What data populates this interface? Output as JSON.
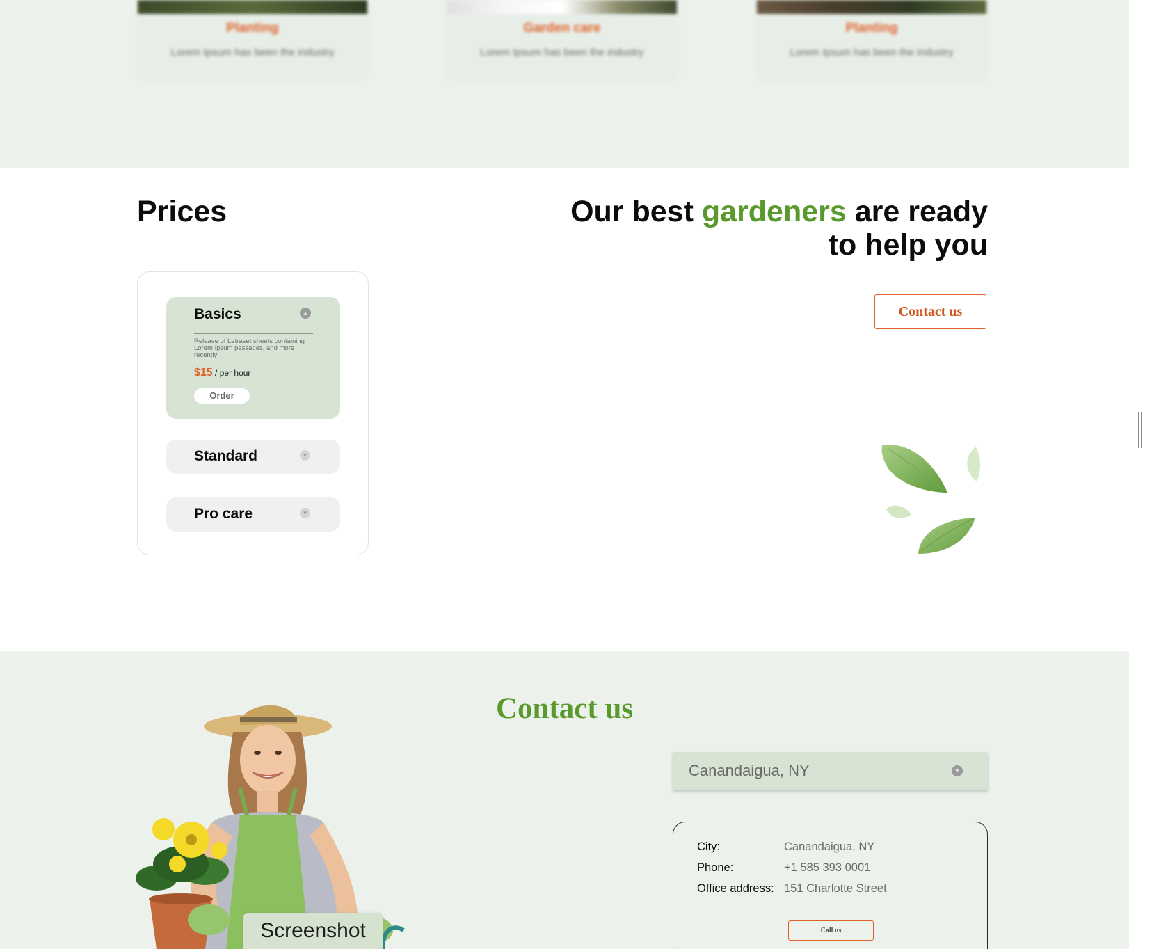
{
  "services": {
    "cards": [
      {
        "title": "Planting",
        "text": "Lorem Ipsum has been the industry"
      },
      {
        "title": "Garden care",
        "text": "Lorem Ipsum has been the industry"
      },
      {
        "title": "Planting",
        "text": "Lorem Ipsum has been the industry"
      }
    ]
  },
  "prices": {
    "title": "Prices",
    "plans": [
      {
        "name": "Basics",
        "description": "Release of Letraset sheets containing Lorem Ipsum passages, and more recently",
        "price": "$15",
        "unit": "/ per hour",
        "order_label": "Order",
        "expanded": true
      },
      {
        "name": "Standard",
        "expanded": false
      },
      {
        "name": "Pro care",
        "expanded": false
      }
    ],
    "toggle_icon_open": "chevron-up-icon",
    "toggle_icon_closed": "chevron-down-icon"
  },
  "promo": {
    "title_start": "Our best ",
    "title_highlight": "gardeners",
    "title_end": " are ready to help you",
    "contact_button": "Contact us"
  },
  "contact": {
    "heading": "Contact us",
    "selected_city": "Canandaigua, NY",
    "info": {
      "city_label": "City:",
      "city_value": "Canandaigua, NY",
      "phone_label": "Phone:",
      "phone_value": "+1 585 393 0001",
      "address_label": "Office address:",
      "address_value": "151 Charlotte Street",
      "call_button": "Call us"
    }
  },
  "overlay": {
    "screenshot_label": "Screenshot"
  },
  "colors": {
    "accent_green": "#5a9a2c",
    "accent_orange": "#e0602a",
    "section_bg": "#ecf1ec",
    "plan_open_bg": "#d7e4d4"
  }
}
